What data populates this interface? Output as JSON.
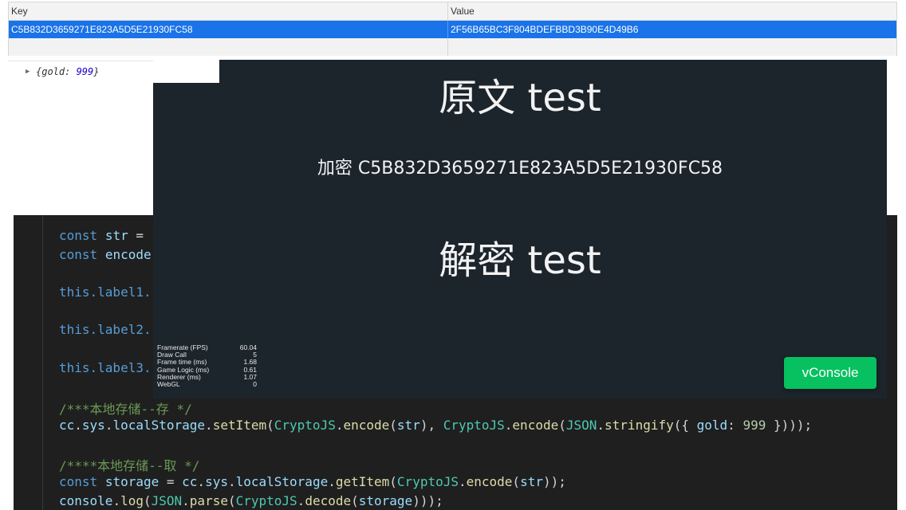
{
  "storage": {
    "header": {
      "key": "Key",
      "value": "Value"
    },
    "rows": [
      {
        "key": "C5B832D3659271E823A5D5E21930FC58",
        "value": "2F56B65BC3F804BDEFBBD3B90E4D49B6"
      }
    ]
  },
  "console": {
    "prefix": "{gold: ",
    "value": "999",
    "suffix": "}"
  },
  "game": {
    "label1": "原文   test",
    "label2": "加密   C5B832D3659271E823A5D5E21930FC58",
    "label3": "解密   test",
    "stats": [
      {
        "label": "Framerate (FPS)",
        "value": "60.04"
      },
      {
        "label": "Draw Call",
        "value": "5"
      },
      {
        "label": "Frame time (ms)",
        "value": "1.68"
      },
      {
        "label": "Game Logic (ms)",
        "value": "0.61"
      },
      {
        "label": "Renderer (ms)",
        "value": "1.07"
      },
      {
        "label": "WebGL",
        "value": "0"
      }
    ],
    "vconsole_label": "vConsole"
  },
  "code": {
    "l1_kw": "const",
    "l1_var": "str",
    "l1_op": " =",
    "l2_kw": "const",
    "l2_var": "encode",
    "l3": "this.label1.",
    "l4": "this.label2.",
    "l5": "this.label3.",
    "comment1": "/***本地存储--存 */",
    "comment2": "/****本地存储--取 */",
    "num": "999",
    "storage_var": "storage"
  }
}
